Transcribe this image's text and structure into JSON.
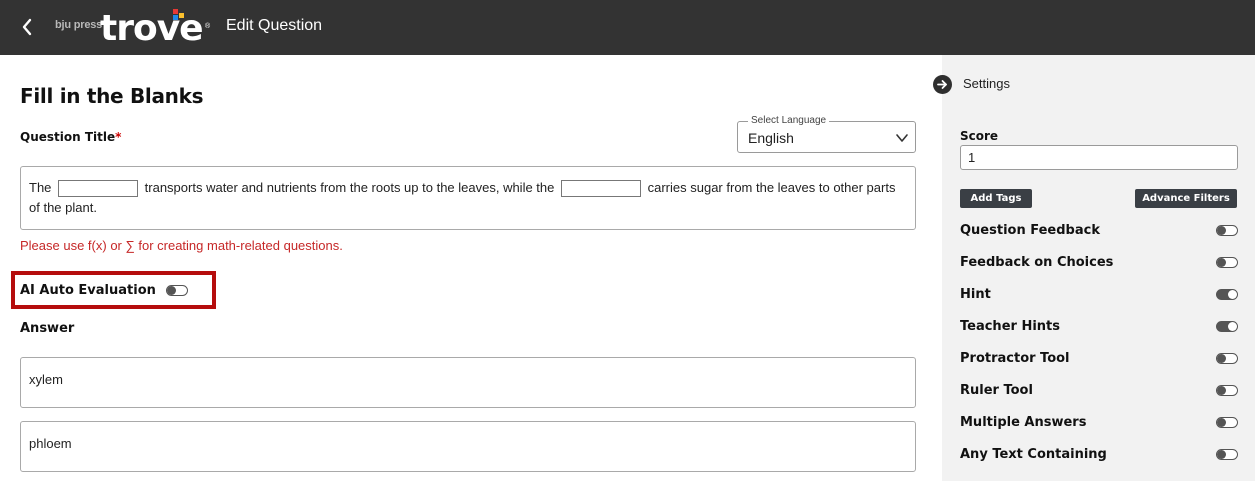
{
  "header": {
    "brand_small": "bju press",
    "brand_big": "trove",
    "brand_mark": "®",
    "title": "Edit Question",
    "back_icon": "chevron-left-icon"
  },
  "main": {
    "heading": "Fill in the Blanks",
    "question_title_label": "Question Title",
    "required_mark": "*",
    "language": {
      "legend": "Select Language",
      "value": "English"
    },
    "question_text": {
      "part1": "The",
      "part2": "transports water and nutrients from the roots up to the leaves, while the",
      "part3": "carries sugar from the leaves to other parts of the plant."
    },
    "math_hint": "Please use f(x) or ∑ for creating math-related questions.",
    "ai_auto_evaluation": {
      "label": "AI Auto Evaluation",
      "enabled": false
    },
    "answer_label": "Answer",
    "answers": [
      "xylem",
      "phloem"
    ]
  },
  "sidebar": {
    "settings_label": "Settings",
    "settings_icon": "arrow-right-circle-icon",
    "score_label": "Score",
    "score_value": "1",
    "add_tags_label": "Add Tags",
    "advance_filters_label": "Advance Filters",
    "options": [
      {
        "label": "Question Feedback",
        "enabled": false
      },
      {
        "label": "Feedback on Choices",
        "enabled": false
      },
      {
        "label": "Hint",
        "enabled": true
      },
      {
        "label": "Teacher Hints",
        "enabled": true
      },
      {
        "label": "Protractor Tool",
        "enabled": false
      },
      {
        "label": "Ruler Tool",
        "enabled": false
      },
      {
        "label": "Multiple Answers",
        "enabled": false
      },
      {
        "label": "Any Text Containing",
        "enabled": false
      }
    ]
  },
  "colors": {
    "topbar": "#333333",
    "accent_red": "#b50d0d",
    "hint_red": "#c62828",
    "sidebar_bg": "#f2f2f2",
    "button_dark": "#3a3f45"
  }
}
